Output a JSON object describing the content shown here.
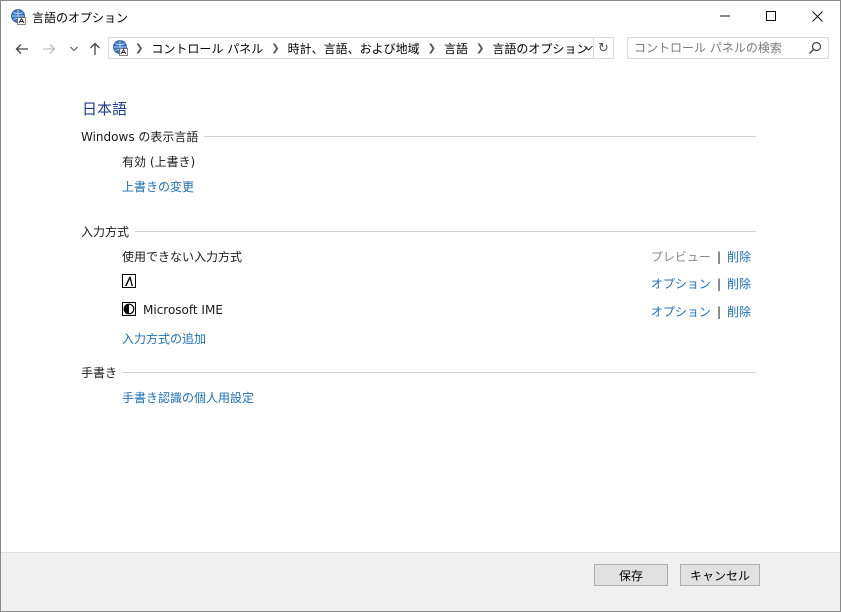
{
  "window": {
    "title": "言語のオプション",
    "icon": "language-globe-icon"
  },
  "navigation": {
    "back_icon": "arrow-left-icon",
    "forward_icon": "arrow-right-icon",
    "recent_icon": "chevron-down-icon",
    "up_icon": "arrow-up-icon",
    "breadcrumbs": [
      "コントロール パネル",
      "時計、言語、および地域",
      "言語",
      "言語のオプション"
    ],
    "search_placeholder": "コントロール パネルの検索"
  },
  "language": {
    "name": "日本語"
  },
  "display_language": {
    "heading": "Windows の表示言語",
    "status": "有効 (上書き)",
    "override_link": "上書きの変更"
  },
  "input_methods": {
    "heading": "入力方式",
    "items": [
      {
        "name": "使用できない入力方式",
        "action1": "プレビュー",
        "action1_enabled": false,
        "action2": "削除",
        "icon": ""
      },
      {
        "name": "",
        "action1": "オプション",
        "action1_enabled": true,
        "action2": "削除",
        "icon": "ime-a-icon"
      },
      {
        "name": "Microsoft IME",
        "action1": "オプション",
        "action1_enabled": true,
        "action2": "削除",
        "icon": "microsoft-ime-icon"
      }
    ],
    "add_link": "入力方式の追加"
  },
  "handwriting": {
    "heading": "手書き",
    "personalization_link": "手書き認識の個人用設定"
  },
  "footer": {
    "save": "保存",
    "cancel": "キャンセル"
  },
  "colors": {
    "link": "#1e6fb8",
    "title": "#1e3e8c",
    "disabled": "#8a8a8a"
  }
}
